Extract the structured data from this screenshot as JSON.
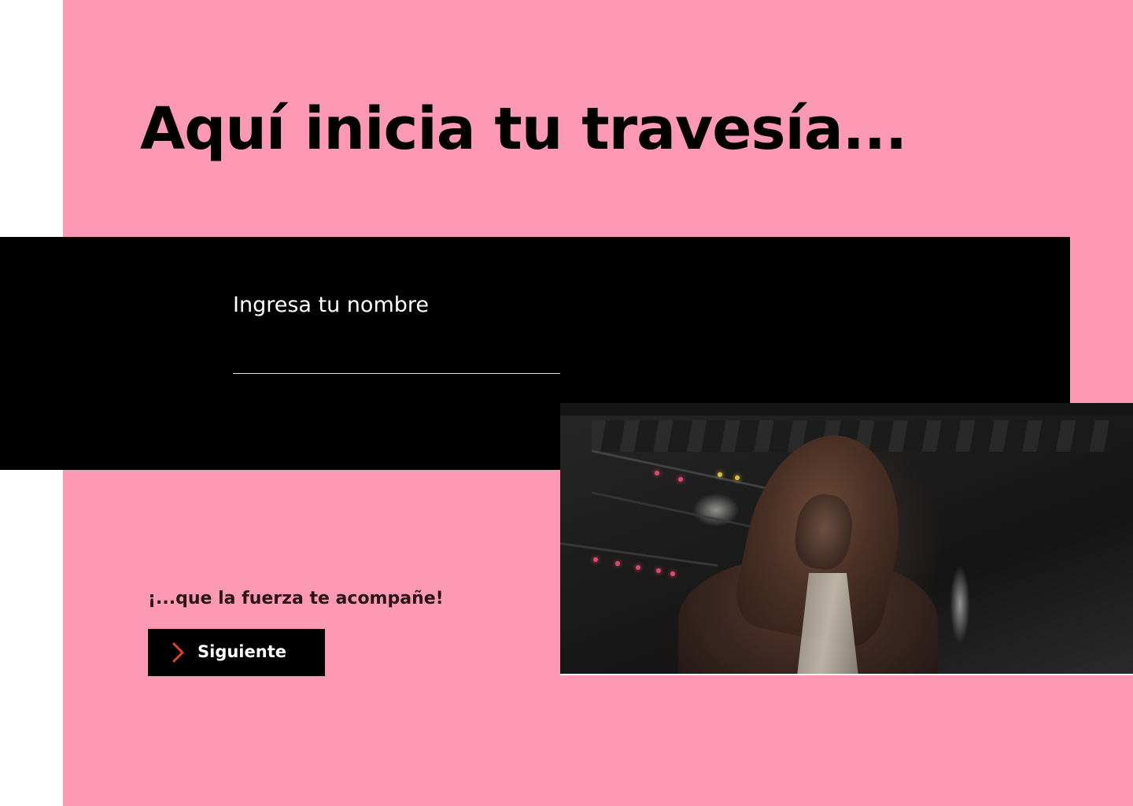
{
  "hero": {
    "title": "Aquí inicia tu travesía..."
  },
  "name_form": {
    "label": "Ingresa tu nombre",
    "input_value": "",
    "input_placeholder": ""
  },
  "footer": {
    "tagline": "¡...que la fuerza te acompañe!",
    "next_button_label": "Siguiente",
    "next_icon": "chevron-right-icon"
  },
  "video": {
    "description_icon": "video-frame"
  },
  "colors": {
    "background_pink": "#fd99b4",
    "band_black": "#000000",
    "chevron_accent": "#e8402a",
    "text_dark": "#2a1418",
    "text_light": "#ffffff"
  }
}
